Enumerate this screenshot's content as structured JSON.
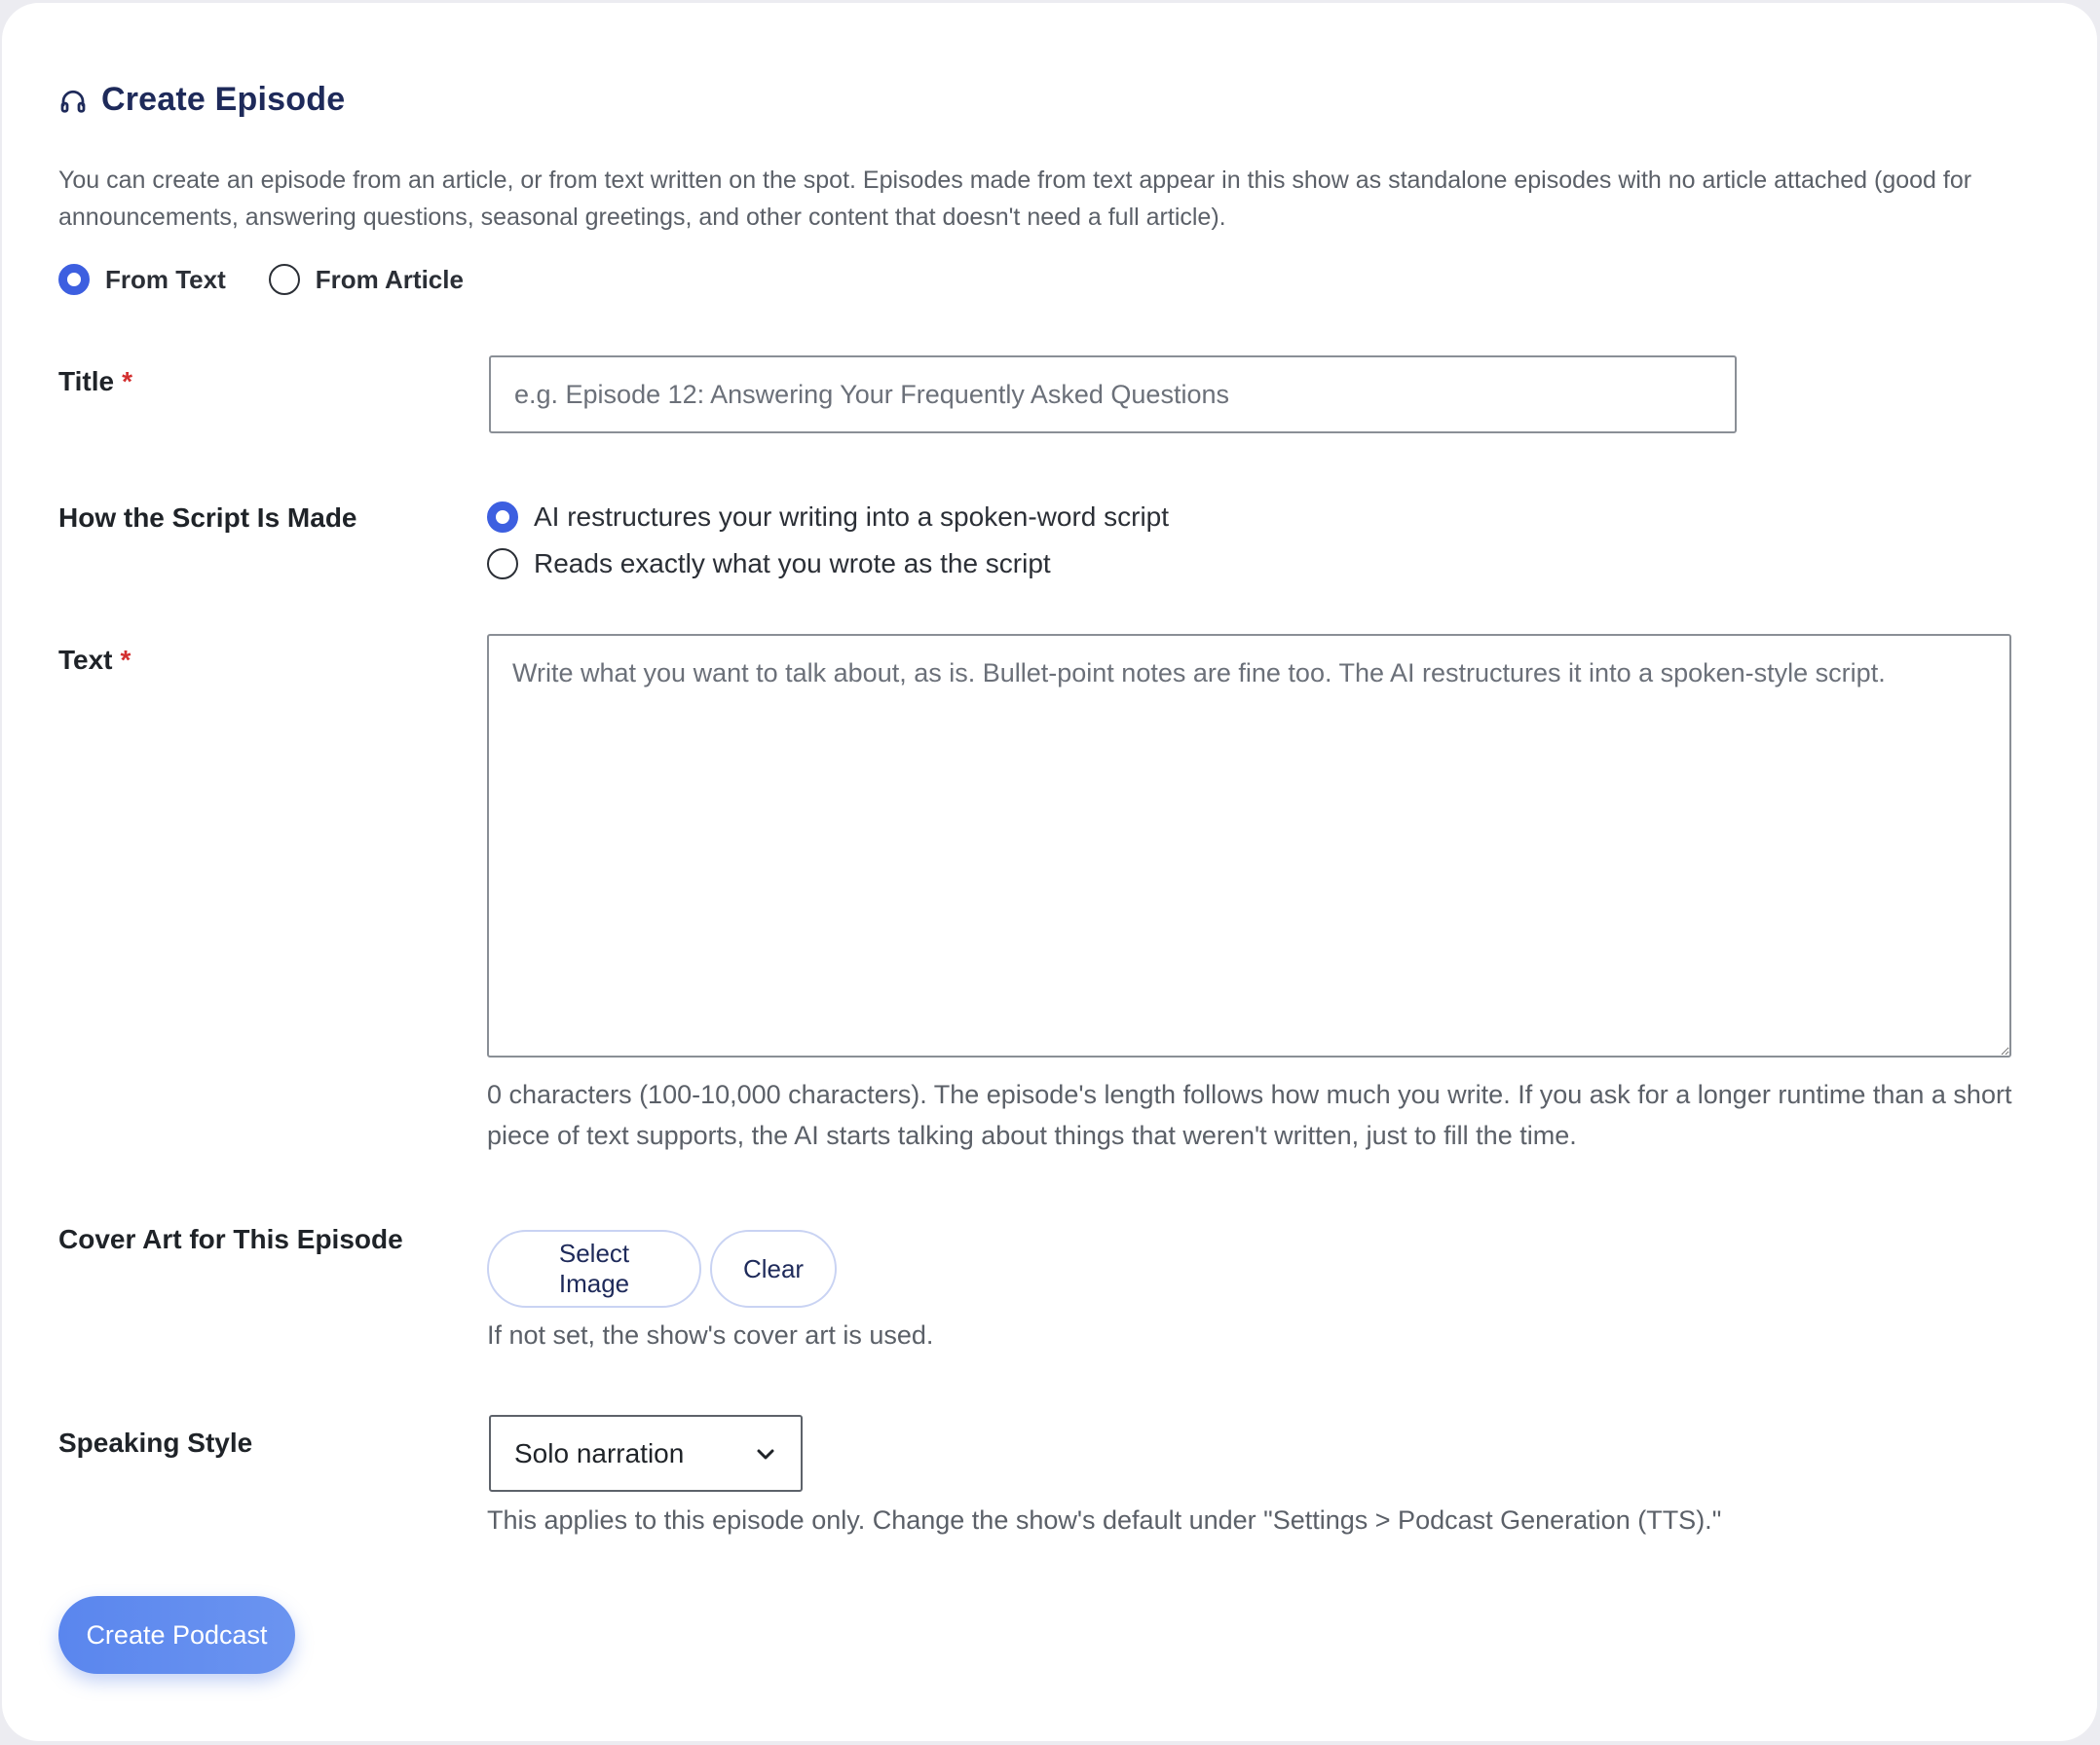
{
  "header": {
    "title": "Create Episode",
    "icon": "headphones-icon"
  },
  "intro": "You can create an episode from an article, or from text written on the spot. Episodes made from text appear in this show as standalone episodes with no article attached (good for announcements, answering questions, seasonal greetings, and other content that doesn't need a full article).",
  "source": {
    "options": [
      {
        "label": "From Text",
        "checked": true
      },
      {
        "label": "From Article",
        "checked": false
      }
    ]
  },
  "form": {
    "required_mark": "*",
    "title": {
      "label": "Title",
      "value": "",
      "placeholder": "e.g. Episode 12: Answering Your Frequently Asked Questions"
    },
    "script": {
      "label": "How the Script Is Made",
      "options": [
        {
          "label": "AI restructures your writing into a spoken-word script",
          "checked": true
        },
        {
          "label": "Reads exactly what you wrote as the script",
          "checked": false
        }
      ]
    },
    "text": {
      "label": "Text",
      "value": "",
      "placeholder": "Write what you want to talk about, as is. Bullet-point notes are fine too. The AI restructures it into a spoken-style script.",
      "help": "0 characters (100-10,000 characters). The episode's length follows how much you write. If you ask for a longer runtime than a short piece of text supports, the AI starts talking about things that weren't written, just to fill the time."
    },
    "cover": {
      "label": "Cover Art for This Episode",
      "select_label": "Select Image",
      "clear_label": "Clear",
      "help": "If not set, the show's cover art is used."
    },
    "speaking_style": {
      "label": "Speaking Style",
      "selected": "Solo narration",
      "help": "This applies to this episode only. Change the show's default under \"Settings > Podcast Generation (TTS).\""
    },
    "submit_label": "Create Podcast"
  },
  "colors": {
    "accent": "#3d5fe0",
    "heading": "#1e2a5a",
    "required": "#d32f2f",
    "primary_button": "#5a86ee"
  }
}
